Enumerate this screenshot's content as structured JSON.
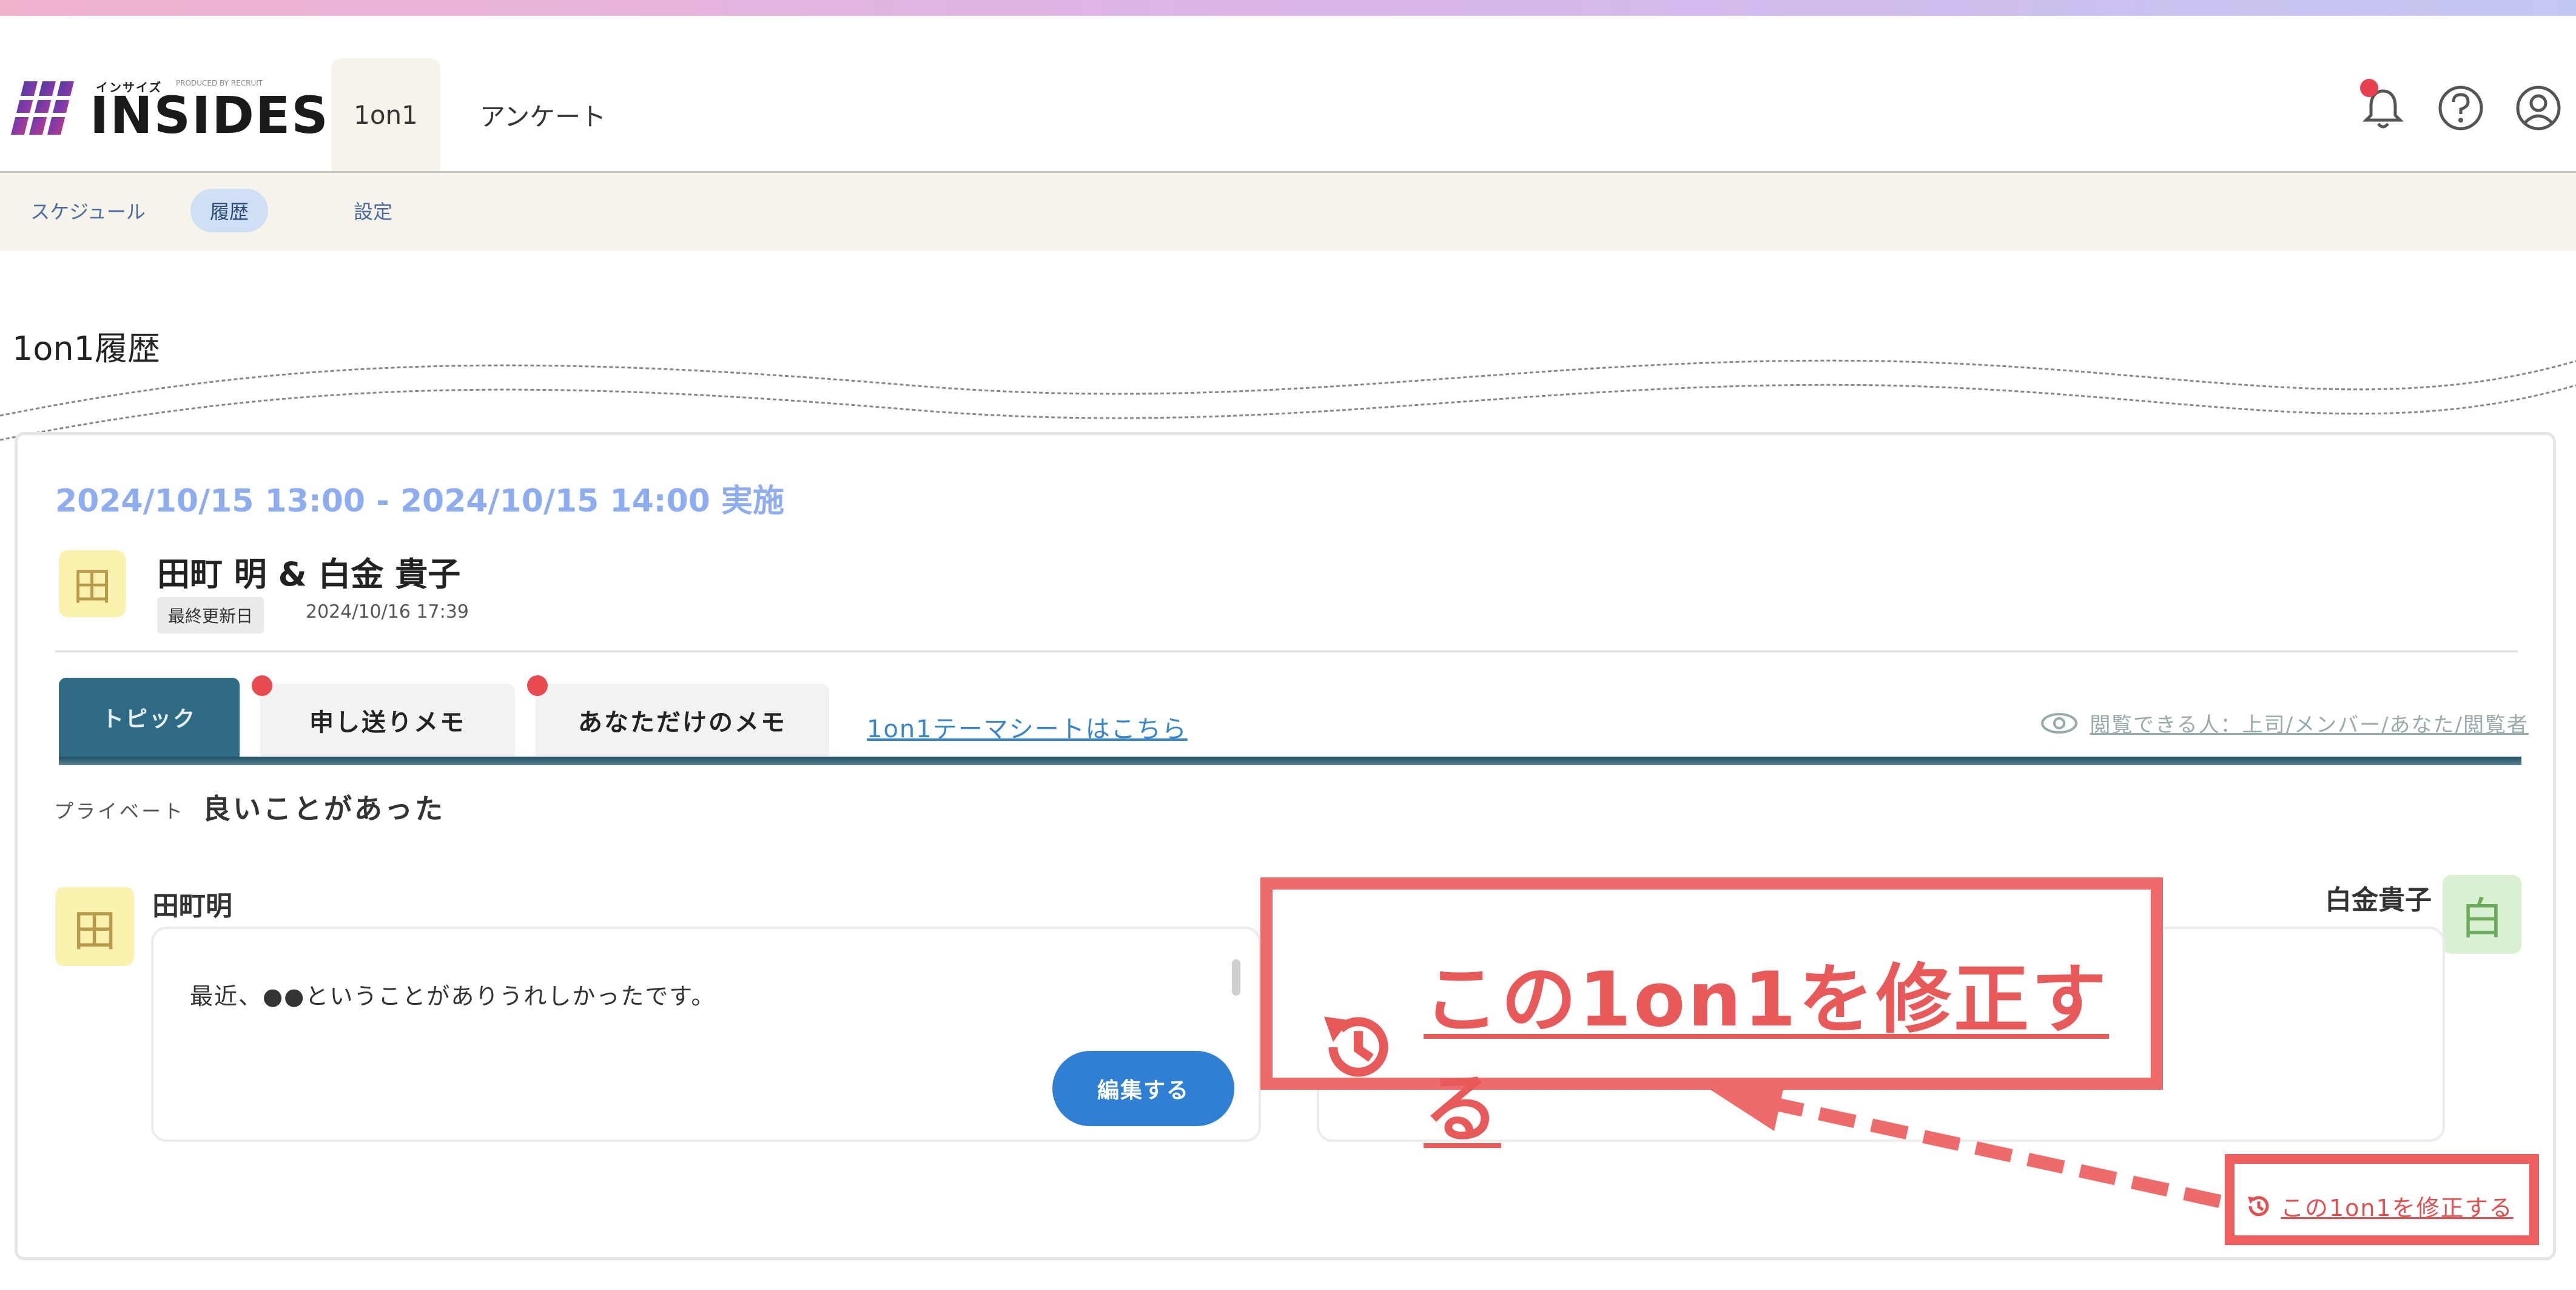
{
  "header": {
    "logo_kana": "インサイズ",
    "logo_text": "INSIDES",
    "logo_small": "PRODUCED BY RECRUIT",
    "tabs": [
      {
        "label": "1on1",
        "active": true
      },
      {
        "label": "アンケート",
        "active": false
      }
    ],
    "icons": [
      "bell-icon",
      "help-icon",
      "user-icon"
    ]
  },
  "subnav": {
    "items": [
      {
        "label": "スケジュール"
      },
      {
        "label": "履歴",
        "active": true
      },
      {
        "label": "設定"
      }
    ]
  },
  "page": {
    "title": "1on1履歴"
  },
  "card": {
    "date": "2024/10/15 13:00 - 2024/10/15 14:00 実施",
    "avatar_char": "田",
    "names": "田町 明 & 白金 貴子",
    "updated_label": "最終更新日",
    "updated_value": "2024/10/16 17:39",
    "tabs": [
      {
        "label": "トピック",
        "active": true
      },
      {
        "label": "申し送りメモ",
        "dot": true
      },
      {
        "label": "あなただけのメモ",
        "dot": true
      }
    ],
    "theme_link": "1on1テーマシートはこちら",
    "viewers": "閲覧できる人：上司/メンバー/あなた/閲覧者",
    "private_label": "プライベート",
    "topic_title": "良いことがあった",
    "left_person": {
      "name": "田町明",
      "avatar": "田",
      "memo": "最近、●●ということがありうれしかったです。",
      "edit_label": "編集する"
    },
    "right_person": {
      "name": "白金貴子",
      "avatar": "白"
    },
    "fix_link": "この1on1を修正する"
  },
  "callout": {
    "text": "この1on1を修正する"
  },
  "colors": {
    "accent": "#2f7fd4",
    "tab_active": "#2f6b84",
    "annotation": "#ef5f5f",
    "date": "#8eacf0"
  }
}
